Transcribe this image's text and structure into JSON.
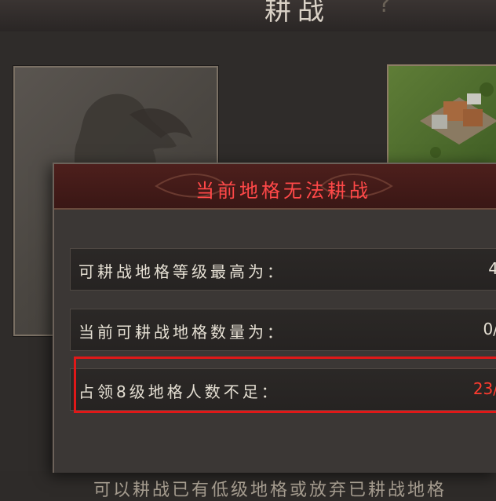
{
  "header": {
    "title": "耕战",
    "help_glyph": "?"
  },
  "dialog": {
    "title": "当前地格无法耕战",
    "rows": [
      {
        "label": "可耕战地格等级最高为：",
        "value": "4"
      },
      {
        "label": "当前可耕战地格数量为：",
        "value": "0/"
      },
      {
        "label": "占领8级地格人数不足：",
        "value": "23/"
      }
    ],
    "note": "可以耕战已有低级地格或放弃已耕战地格"
  },
  "colors": {
    "dialog_title": "#ff4848",
    "warning_value": "#ff3b2f",
    "highlight_border": "#e01818"
  },
  "icons": {
    "help": "question-mark-icon"
  }
}
